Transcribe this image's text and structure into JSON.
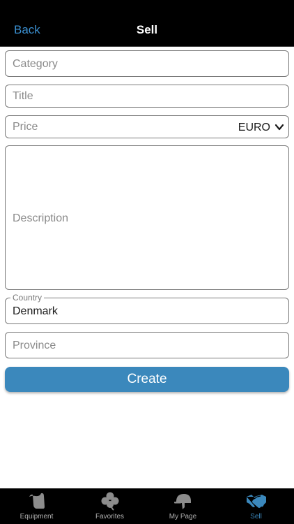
{
  "nav": {
    "back_label": "Back",
    "title": "Sell"
  },
  "form": {
    "category_placeholder": "Category",
    "title_placeholder": "Title",
    "price_placeholder": "Price",
    "currency_value": "EURO",
    "description_placeholder": "Description",
    "country_label": "Country",
    "country_value": "Denmark",
    "province_placeholder": "Province",
    "create_label": "Create"
  },
  "tabs": [
    {
      "label": "Equipment",
      "icon": "saddle-icon",
      "active": false
    },
    {
      "label": "Favorites",
      "icon": "clover-icon",
      "active": false
    },
    {
      "label": "My Page",
      "icon": "riding-helmet-icon",
      "active": false
    },
    {
      "label": "Sell",
      "icon": "handshake-icon",
      "active": true
    }
  ],
  "colors": {
    "accent": "#3b88bc",
    "back_link": "#3a8fd0",
    "bar": "#000000",
    "inactive_icon": "#8c8c8c"
  }
}
